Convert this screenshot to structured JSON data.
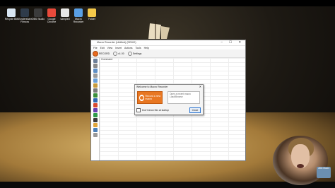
{
  "desktop_icons": [
    {
      "label": "Recycle Bin",
      "color": "#d9e6f2"
    },
    {
      "label": "Wondershare Filmora",
      "color": "#2f3b4a"
    },
    {
      "label": "OBS Studio",
      "color": "#3b3b3b"
    },
    {
      "label": "Google Chrome",
      "color": "#e84a3b"
    },
    {
      "label": "sampled",
      "color": "#e8e8e8"
    },
    {
      "label": "Macro Recorder",
      "color": "#5aa0e6"
    },
    {
      "label": "Folder",
      "color": "#f4c84a"
    }
  ],
  "window": {
    "title": "Macro Recorder (Untitled) (DEMO)",
    "controls": "–  ☐  ✕",
    "menu": [
      "File",
      "Edit",
      "View",
      "Insert",
      "Actions",
      "Tools",
      "Help"
    ],
    "toolbar": {
      "record_label": "RECORD",
      "speed_label": "x1.00",
      "settings_label": "Settings"
    },
    "grid": {
      "column_header": "Command"
    }
  },
  "dialog": {
    "title": "Welcome to Macro Recorder",
    "record_button": "Record a new macro",
    "open_box_title": "Open a recent macro",
    "open_box_item": "Load/Browse",
    "checkbox_label": "Don't show this at startup",
    "close_button": "Close"
  },
  "webcam": {
    "logo_text": "Jitbit Macro"
  },
  "colors": {
    "accent": "#e87722",
    "desk_sand": "#d8b46a"
  }
}
